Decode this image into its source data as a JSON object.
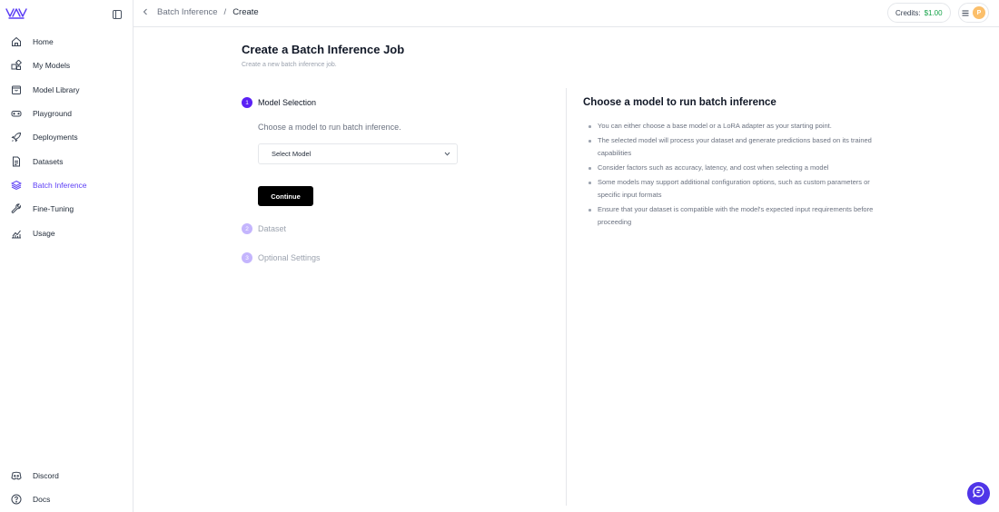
{
  "sidebar": {
    "items": [
      {
        "label": "Home",
        "icon": "home-icon"
      },
      {
        "label": "My Models",
        "icon": "models-icon"
      },
      {
        "label": "Model Library",
        "icon": "library-icon"
      },
      {
        "label": "Playground",
        "icon": "gamepad-icon"
      },
      {
        "label": "Deployments",
        "icon": "rocket-icon"
      },
      {
        "label": "Datasets",
        "icon": "document-icon"
      },
      {
        "label": "Batch Inference",
        "icon": "layers-icon",
        "active": true
      },
      {
        "label": "Fine-Tuning",
        "icon": "wrench-icon"
      },
      {
        "label": "Usage",
        "icon": "chart-icon"
      }
    ],
    "bottom_items": [
      {
        "label": "Discord",
        "icon": "discord-icon"
      },
      {
        "label": "Docs",
        "icon": "help-icon"
      }
    ]
  },
  "header": {
    "breadcrumb": [
      "Batch Inference",
      "Create"
    ],
    "breadcrumb_sep": "/",
    "credits_label": "Credits:",
    "credits_value": "$1.00",
    "avatar_initial": "P"
  },
  "main": {
    "title": "Create a Batch Inference Job",
    "subtitle": "Create a new batch inference job.",
    "steps": [
      {
        "num": "1",
        "label": "Model Selection"
      },
      {
        "num": "2",
        "label": "Dataset"
      },
      {
        "num": "3",
        "label": "Optional Settings"
      }
    ],
    "step_description": "Choose a model to run batch inference.",
    "select_placeholder": "Select Model",
    "continue_label": "Continue"
  },
  "info": {
    "title": "Choose a model to run batch inference",
    "bullets": [
      "You can either choose a base model or a LoRA adapter as your starting point.",
      "The selected model will process your dataset and generate predictions based on its trained capabilities",
      "Consider factors such as accuracy, latency, and cost when selecting a model",
      "Some models may support additional configuration options, such as custom parameters or specific input formats",
      "Ensure that your dataset is compatible with the model's expected input requirements before proceeding"
    ]
  },
  "colors": {
    "accent": "#5b3df5",
    "credits": "#16a34a",
    "avatar": "#fbbf6b"
  }
}
